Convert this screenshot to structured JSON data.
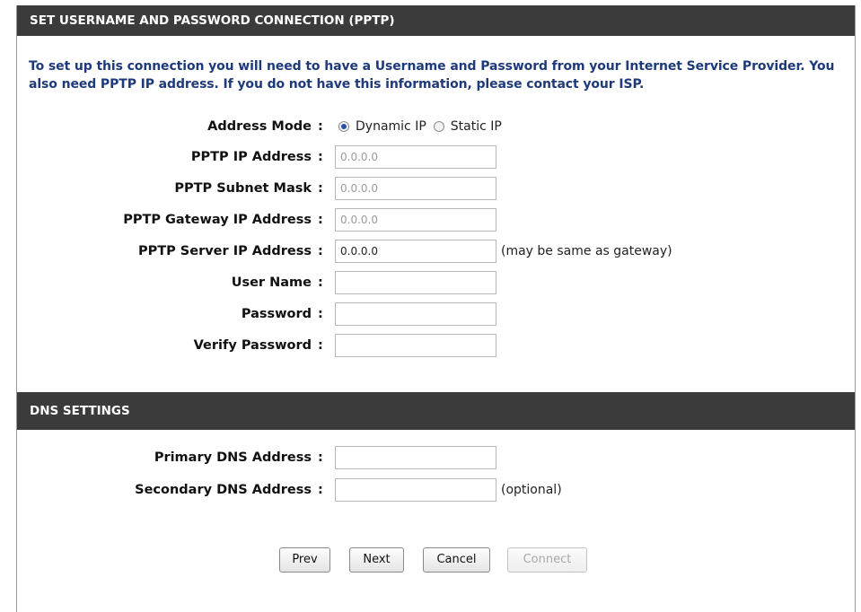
{
  "pptp": {
    "header": "SET USERNAME AND PASSWORD CONNECTION (PPTP)",
    "intro": "To set up this connection you will need to have a Username and Password from your Internet Service Provider. You also need PPTP IP address. If you do not have this information, please contact your ISP.",
    "address_mode": {
      "label": "Address Mode",
      "options": [
        "Dynamic IP",
        "Static IP"
      ],
      "selected": "Dynamic IP"
    },
    "ip_address": {
      "label": "PPTP IP Address",
      "value": "0.0.0.0"
    },
    "subnet_mask": {
      "label": "PPTP Subnet Mask",
      "value": "0.0.0.0"
    },
    "gateway": {
      "label": "PPTP Gateway IP Address",
      "value": "0.0.0.0"
    },
    "server": {
      "label": "PPTP Server IP Address",
      "value": "0.0.0.0",
      "note": "(may be same as gateway)"
    },
    "username": {
      "label": "User Name",
      "value": ""
    },
    "password": {
      "label": "Password",
      "value": ""
    },
    "verify_password": {
      "label": "Verify Password",
      "value": ""
    }
  },
  "dns": {
    "header": "DNS SETTINGS",
    "primary": {
      "label": "Primary DNS Address",
      "value": ""
    },
    "secondary": {
      "label": "Secondary DNS Address",
      "value": "",
      "note": "(optional)"
    }
  },
  "buttons": {
    "prev": "Prev",
    "next": "Next",
    "cancel": "Cancel",
    "connect": "Connect"
  },
  "colon": ":"
}
